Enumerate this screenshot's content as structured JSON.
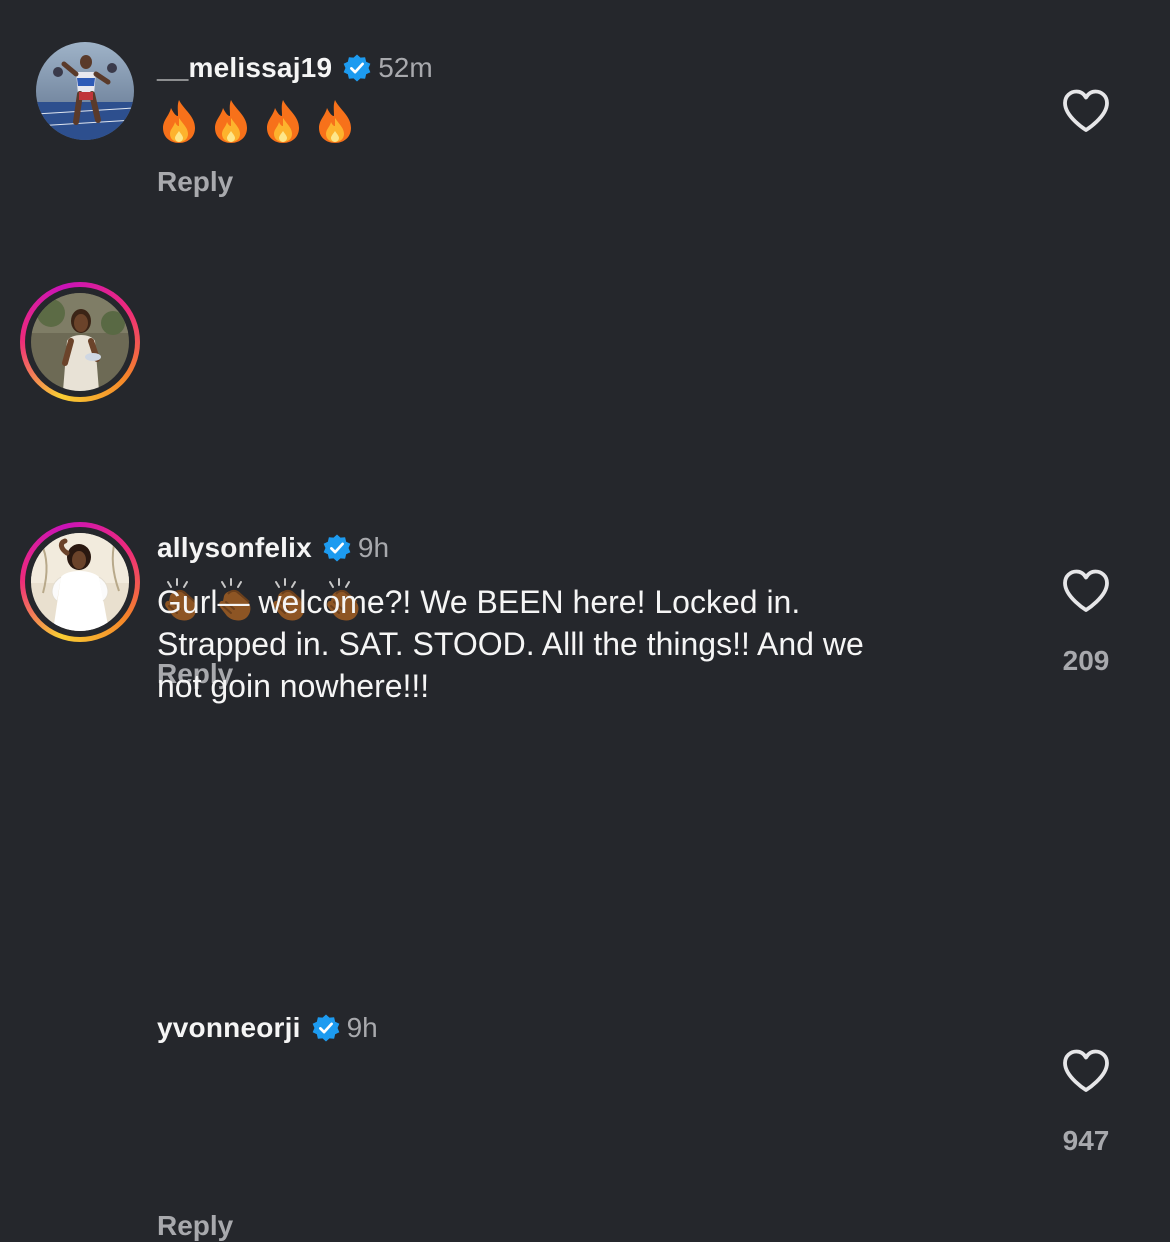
{
  "colors": {
    "background": "#25272c",
    "text_primary": "#f5f5f5",
    "text_secondary": "#a8a9ad",
    "verified_blue": "#1d9bf0"
  },
  "comments": [
    {
      "username": "__melissaj19",
      "verified": true,
      "time": "52m",
      "emojis": [
        "🔥",
        "🔥",
        "🔥",
        "🔥"
      ],
      "text": "",
      "reply_label": "Reply",
      "likes": "",
      "avatar_icon": "sprinter-photo",
      "has_story_ring": false
    },
    {
      "username": "allysonfelix",
      "verified": true,
      "time": "9h",
      "emojis": [
        "👏🏾",
        "👏🏾",
        "👏🏾",
        "👏🏾"
      ],
      "text": "",
      "reply_label": "Reply",
      "likes": "209",
      "avatar_icon": "woman-photo",
      "has_story_ring": true
    },
    {
      "username": "yvonneorji",
      "verified": true,
      "time": "9h",
      "emojis": [],
      "text": "Gurl— welcome?! We BEEN here! Locked in.\nStrapped in. SAT. STOOD. Alll the things!! And we\nnot goin nowhere!!!",
      "reply_label": "Reply",
      "likes": "947",
      "avatar_icon": "woman-white-dress-photo",
      "has_story_ring": true
    }
  ]
}
